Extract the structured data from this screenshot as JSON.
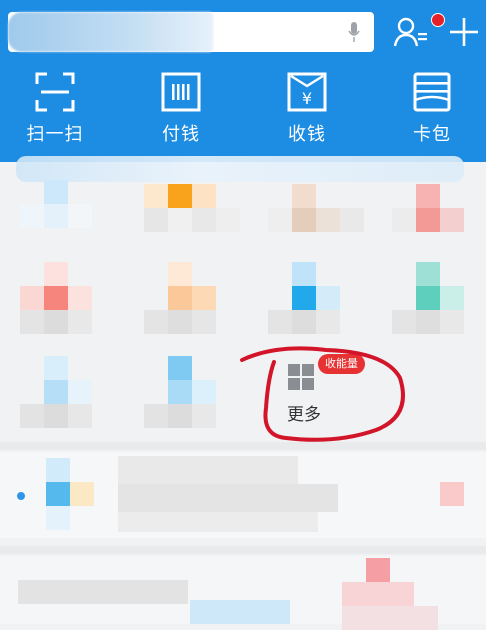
{
  "search": {
    "value": ""
  },
  "actions": [
    {
      "label": "扫一扫",
      "icon": "scan-icon"
    },
    {
      "label": "付钱",
      "icon": "barcode-icon"
    },
    {
      "label": "收钱",
      "icon": "receive-money-icon"
    },
    {
      "label": "卡包",
      "icon": "card-wallet-icon"
    }
  ],
  "more": {
    "label": "更多",
    "badge": "收能量"
  },
  "colors": {
    "header": "#1d8ce3",
    "annotation": "#d3152a",
    "badge": "#e63232"
  }
}
